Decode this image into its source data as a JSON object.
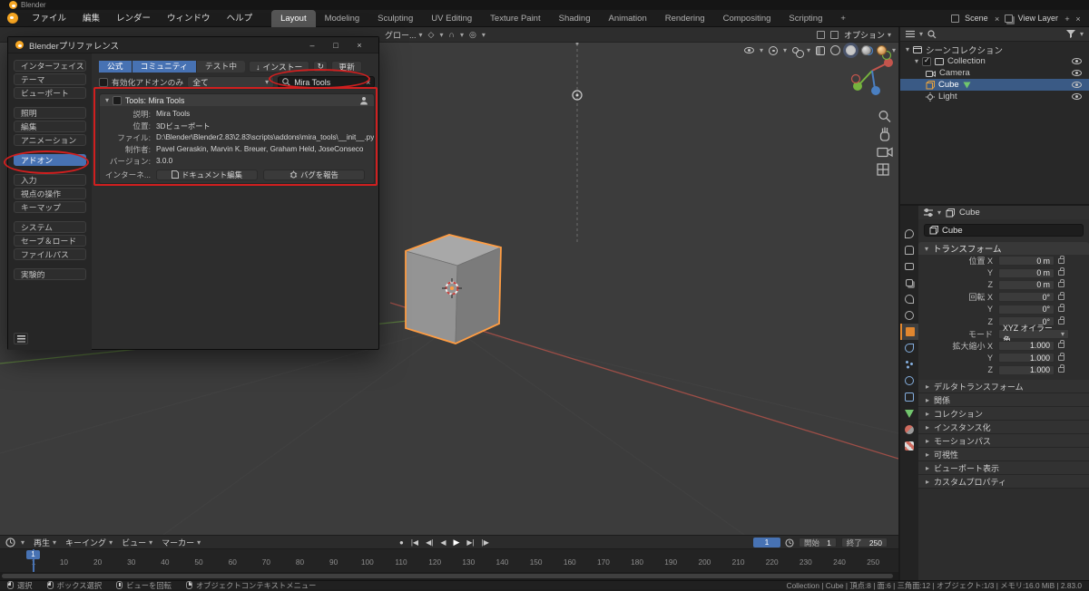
{
  "app": {
    "window_title": "Blender"
  },
  "icons": {
    "dropdown": "▾",
    "collapsed": "▸",
    "expanded": "▾",
    "close": "×",
    "minimize": "–",
    "maximize": "□",
    "pivot": "◇",
    "magnet": "∩",
    "proportional": "◎",
    "install_arrow": "↓",
    "refresh": "↻"
  },
  "topbar": {
    "menus": [
      {
        "label": "ファイル"
      },
      {
        "label": "編集"
      },
      {
        "label": "レンダー"
      },
      {
        "label": "ウィンドウ"
      },
      {
        "label": "ヘルプ"
      }
    ],
    "workspaces": [
      {
        "label": "Layout",
        "selected": true
      },
      {
        "label": "Modeling"
      },
      {
        "label": "Sculpting"
      },
      {
        "label": "UV Editing"
      },
      {
        "label": "Texture Paint"
      },
      {
        "label": "Shading"
      },
      {
        "label": "Animation"
      },
      {
        "label": "Rendering"
      },
      {
        "label": "Compositing"
      },
      {
        "label": "Scripting"
      },
      {
        "label": "+"
      }
    ],
    "scene": {
      "label": "Scene"
    },
    "view_layer": {
      "label": "View Layer"
    }
  },
  "preferences": {
    "title": "Blenderプリファレンス",
    "sidebar": [
      {
        "label": "インターフェイス"
      },
      {
        "label": "テーマ"
      },
      {
        "label": "ビューポート"
      },
      {
        "label": "照明",
        "gap": true
      },
      {
        "label": "編集"
      },
      {
        "label": "アニメーション"
      },
      {
        "label": "アドオン",
        "gap": true,
        "selected": true
      },
      {
        "label": "入力",
        "gap": true
      },
      {
        "label": "視点の操作"
      },
      {
        "label": "キーマップ"
      },
      {
        "label": "システム",
        "gap": true
      },
      {
        "label": "セーブ＆ロード"
      },
      {
        "label": "ファイルパス"
      },
      {
        "label": "実験的",
        "gap": true
      }
    ],
    "tabs": [
      {
        "label": "公式",
        "selected": true
      },
      {
        "label": "コミュニティ",
        "selected": true
      },
      {
        "label": "テスト中"
      }
    ],
    "install_button": "インストー",
    "update_button": "更新",
    "enabled_only": "有効化アドオンのみ",
    "filter_dropdown": "全て",
    "search_value": "Mira Tools",
    "addon": {
      "title": "Tools: Mira Tools",
      "rows": [
        {
          "label": "説明:",
          "value": "Mira Tools"
        },
        {
          "label": "位置:",
          "value": "3Dビューポート"
        },
        {
          "label": "ファイル:",
          "value": "D:\\Blender\\Blender2.83\\2.83\\scripts\\addons\\mira_tools\\__init__.py"
        },
        {
          "label": "制作者:",
          "value": "Pavel Geraskin, Marvin K. Breuer, Graham Held, JoseConseco"
        },
        {
          "label": "バージョン:",
          "value": "3.0.0"
        }
      ],
      "internet_label": "インターネ...",
      "doc_button": "ドキュメント編集",
      "bug_button": "バグを報告"
    }
  },
  "viewport": {
    "orientation": "グロー...",
    "options_button": "オプション"
  },
  "outliner": {
    "rows": [
      {
        "label": "シーンコレクション"
      },
      {
        "label": "Collection"
      },
      {
        "label": "Camera"
      },
      {
        "label": "Cube",
        "selected": true
      },
      {
        "label": "Light"
      }
    ]
  },
  "properties": {
    "breadcrumb": "Cube",
    "name_field": "Cube",
    "transform_title": "トランスフォーム",
    "fields": [
      {
        "label": "位置 X",
        "value": "0 m"
      },
      {
        "label": "Y",
        "value": "0 m"
      },
      {
        "label": "Z",
        "value": "0 m"
      },
      {
        "label": "回転 X",
        "value": "0°"
      },
      {
        "label": "Y",
        "value": "0°"
      },
      {
        "label": "Z",
        "value": "0°"
      },
      {
        "label": "モード",
        "value": "XYZ オイラー角",
        "dropdown": true
      },
      {
        "label": "拡大縮小 X",
        "value": "1.000"
      },
      {
        "label": "Y",
        "value": "1.000"
      },
      {
        "label": "Z",
        "value": "1.000"
      }
    ],
    "sections": [
      {
        "label": "デルタトランスフォーム"
      },
      {
        "label": "関係"
      },
      {
        "label": "コレクション"
      },
      {
        "label": "インスタンス化"
      },
      {
        "label": "モーションパス"
      },
      {
        "label": "可視性"
      },
      {
        "label": "ビューポート表示"
      },
      {
        "label": "カスタムプロパティ"
      }
    ],
    "tab_icons": [
      "tool",
      "render",
      "output",
      "view-layer",
      "scene",
      "world",
      "object",
      "modifiers",
      "particles",
      "physics",
      "constraints",
      "object-data",
      "material",
      "texture"
    ]
  },
  "timeline": {
    "menus": [
      {
        "label": "再生"
      },
      {
        "label": "キーイング"
      },
      {
        "label": "ビュー"
      },
      {
        "label": "マーカー"
      }
    ],
    "transport": [
      {
        "label": "●"
      },
      {
        "label": "|◀"
      },
      {
        "label": "◀|"
      },
      {
        "label": "◀"
      },
      {
        "label": "▶",
        "selected": true
      },
      {
        "label": "▶|"
      },
      {
        "label": "|▶"
      }
    ],
    "current_frame": "1",
    "start_label": "開始",
    "start_value": "1",
    "end_label": "終了",
    "end_value": "250",
    "ticks": [
      {
        "label": "1"
      },
      {
        "label": "10"
      },
      {
        "label": "20"
      },
      {
        "label": "30"
      },
      {
        "label": "40"
      },
      {
        "label": "50"
      },
      {
        "label": "60"
      },
      {
        "label": "70"
      },
      {
        "label": "80"
      },
      {
        "label": "90"
      },
      {
        "label": "100"
      },
      {
        "label": "110"
      },
      {
        "label": "120"
      },
      {
        "label": "130"
      },
      {
        "label": "140"
      },
      {
        "label": "150"
      },
      {
        "label": "160"
      },
      {
        "label": "170"
      },
      {
        "label": "180"
      },
      {
        "label": "190"
      },
      {
        "label": "200"
      },
      {
        "label": "210"
      },
      {
        "label": "220"
      },
      {
        "label": "230"
      },
      {
        "label": "240"
      },
      {
        "label": "250"
      }
    ]
  },
  "statusbar": {
    "hints": [
      {
        "label": "選択"
      },
      {
        "label": "ボックス選択"
      },
      {
        "label": "ビューを回転"
      },
      {
        "label": "オブジェクトコンテキストメニュー"
      }
    ],
    "info": "Collection | Cube | 頂点:8 | 面:6 | 三角面:12 | オブジェクト:1/3 | メモリ:16.0 MiB | 2.83.0"
  },
  "colors": {
    "accent": "#4772b3",
    "selection_orange": "#ff9d43",
    "annotation_red": "#d01f1f"
  }
}
